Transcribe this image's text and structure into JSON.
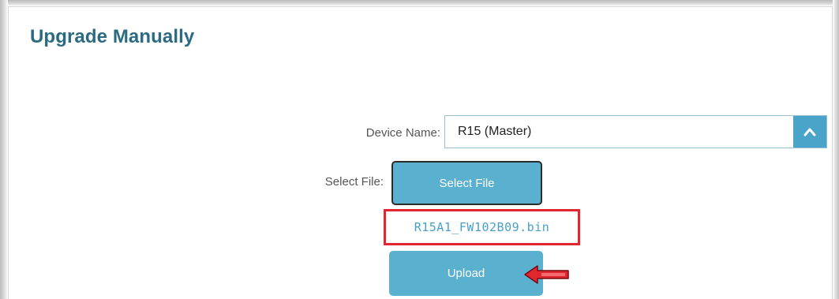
{
  "section": {
    "title": "Upgrade Manually"
  },
  "form": {
    "device_label": "Device Name:",
    "device_value": "R15 (Master)",
    "file_label": "Select File:",
    "select_file_button": "Select File",
    "selected_file_name": "R15A1_FW102B09.bin",
    "upload_button": "Upload"
  },
  "colors": {
    "accent": "#4aa3c8",
    "title": "#2b6b82",
    "highlight": "#e0262f"
  },
  "icons": {
    "dropdown": "chevron-up-icon",
    "annotation": "arrow-left-icon"
  }
}
